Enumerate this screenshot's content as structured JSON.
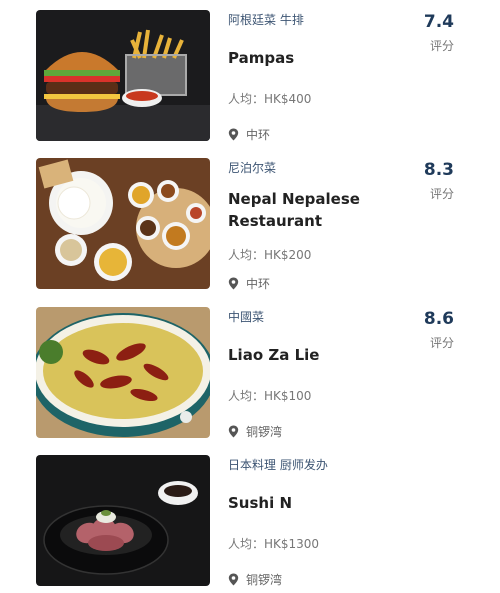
{
  "restaurants": [
    {
      "cuisine": "阿根廷菜 牛排",
      "name": "Pampas",
      "price": "人均：HK$400",
      "location": "中环",
      "score": "7.4",
      "score_label": "评分",
      "image": "burger-and-fries"
    },
    {
      "cuisine": "尼泊尔菜",
      "name_line1": "Nepal Nepalese",
      "name_line2": "Restaurant",
      "price": "人均：HK$200",
      "location": "中环",
      "score": "8.3",
      "score_label": "评分",
      "image": "nepalese-platter"
    },
    {
      "cuisine": "中國菜",
      "name": "Liao Za Lie",
      "price": "人均：HK$100",
      "location": "铜锣湾",
      "score": "8.6",
      "score_label": "评分",
      "image": "spicy-fish-bowl"
    },
    {
      "cuisine": "日本料理 厨师发办",
      "name": "Sushi N",
      "price": "人均：HK$1300",
      "location": "铜锣湾",
      "image": "beef-rice-bowl"
    }
  ],
  "colors": {
    "cuisine_text": "#3d5573",
    "score_text": "#1f3a5a",
    "muted_text": "#777777"
  },
  "icons": {
    "location": "map-pin-icon"
  }
}
